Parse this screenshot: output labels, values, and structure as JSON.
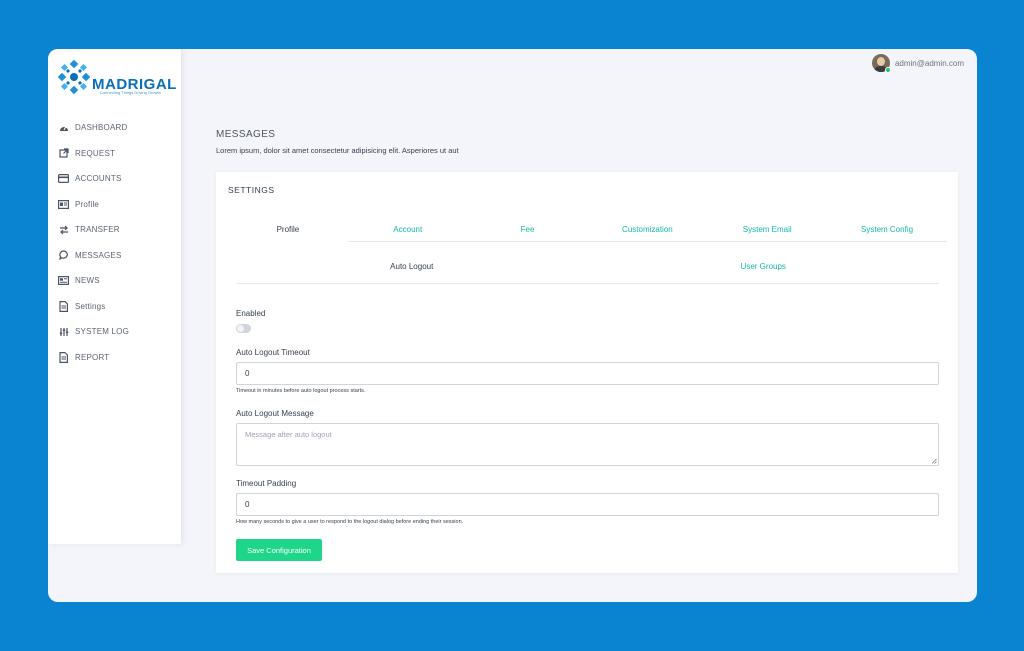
{
  "brand": {
    "name": "MADRIGAL",
    "tagline": "Connecting Things Driving Growth",
    "primary_color": "#0a6fb8"
  },
  "user": {
    "email": "admin@admin.com",
    "status_color": "#22c55e"
  },
  "sidebar": {
    "items": [
      {
        "label": "DASHBOARD",
        "icon": "tachometer-icon"
      },
      {
        "label": "REQUEST",
        "icon": "external-link-icon"
      },
      {
        "label": "ACCOUNTS",
        "icon": "credit-card-icon"
      },
      {
        "label": "Profile",
        "icon": "id-card-icon"
      },
      {
        "label": "TRANSFER",
        "icon": "exchange-icon"
      },
      {
        "label": "MESSAGES",
        "icon": "chat-bubble-icon"
      },
      {
        "label": "NEWS",
        "icon": "newspaper-icon"
      },
      {
        "label": "Settings",
        "icon": "file-icon"
      },
      {
        "label": "SYSTEM LOG",
        "icon": "sliders-icon"
      },
      {
        "label": "REPORT",
        "icon": "file-icon"
      }
    ]
  },
  "header": {
    "title": "MESSAGES",
    "subtitle": "Lorem ipsum, dolor sit amet consectetur adipisicing elit. Asperiores ut aut"
  },
  "settings": {
    "title": "SETTINGS",
    "tabs": [
      {
        "label": "Profile",
        "active": true
      },
      {
        "label": "Account",
        "active": false
      },
      {
        "label": "Fee",
        "active": false
      },
      {
        "label": "Customization",
        "active": false
      },
      {
        "label": "System Email",
        "active": false
      },
      {
        "label": "System Config",
        "active": false
      }
    ],
    "subtabs": [
      {
        "label": "Auto Logout",
        "active": true
      },
      {
        "label": "User Groups",
        "active": false
      }
    ],
    "form": {
      "enabled_label": "Enabled",
      "enabled": false,
      "timeout_label": "Auto Logout Timeout",
      "timeout_value": "0",
      "timeout_help": "Timeout in minutes before auto logout process starts.",
      "message_label": "Auto Logout Message",
      "message_placeholder": "Message after auto logout",
      "padding_label": "Timeout Padding",
      "padding_value": "0",
      "padding_help": "How many seconds to give a user to respond to the logout dialog before ending their session.",
      "save_label": "Save Configuration"
    },
    "accent_color": "#14b8a6",
    "button_color": "#1ed68a"
  }
}
